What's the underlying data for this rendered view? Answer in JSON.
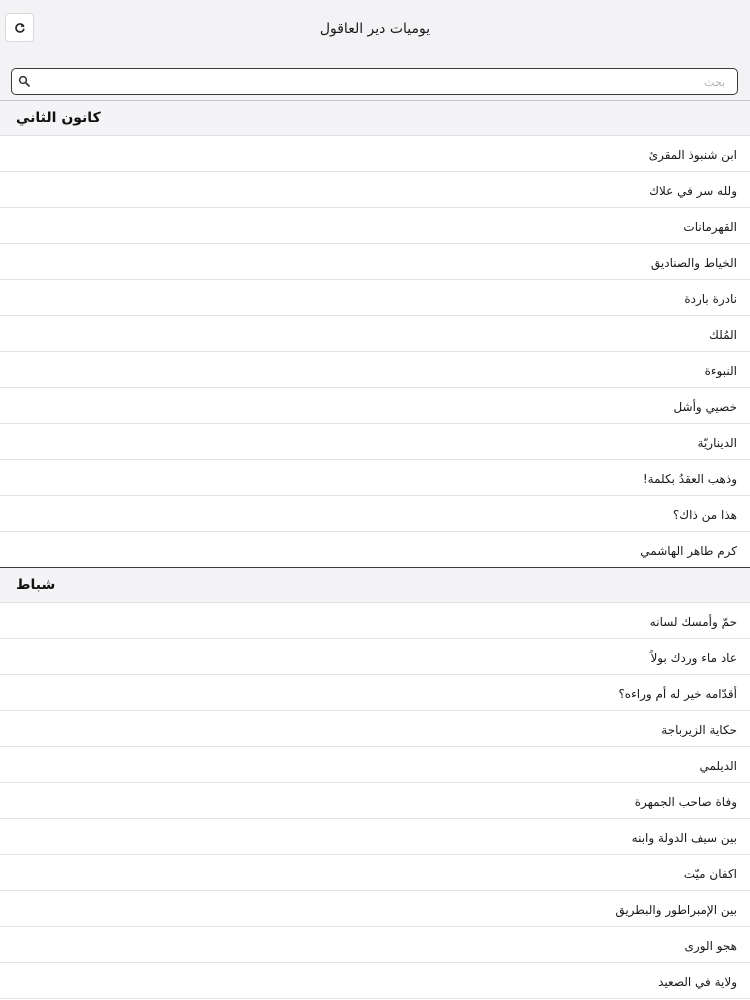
{
  "app": {
    "title": "يوميات دير العاقول"
  },
  "search": {
    "placeholder": "بحث",
    "value": ""
  },
  "sections": [
    {
      "header": "كانون الثاني",
      "items": [
        "ابن شنبوذ المقرئ",
        "ولله سر في علاك",
        "القهرمانات",
        "الخياط والصناديق",
        "نادرة باردة",
        "المُلك",
        "النبوءة",
        "خصيي وأشل",
        "الديناريّة",
        "وذهب العقدُ بكلمة!",
        "هذا من ذاك؟",
        "كرم طاهر الهاشمي"
      ]
    },
    {
      "header": "شباط",
      "items": [
        "حمّ وأمسك لسانه",
        "عاد ماء وردك بولاً",
        "أقدّامه خير له أم وراءه؟",
        "حكاية الزيرباجة",
        "الديلمي",
        "وفاة صاحب الجمهرة",
        "بين سيف الدولة وابنه",
        "اكفان ميّت",
        "بين الإمبراطور والبطريق",
        "هجو الورى",
        "ولاية في الصعيد"
      ]
    }
  ],
  "icons": {
    "refresh": "refresh-icon",
    "search": "search-icon"
  },
  "colors": {
    "bar_background": "#f3f3f5",
    "section_background": "#f4f4f6",
    "separator": "#e4e4e6"
  }
}
